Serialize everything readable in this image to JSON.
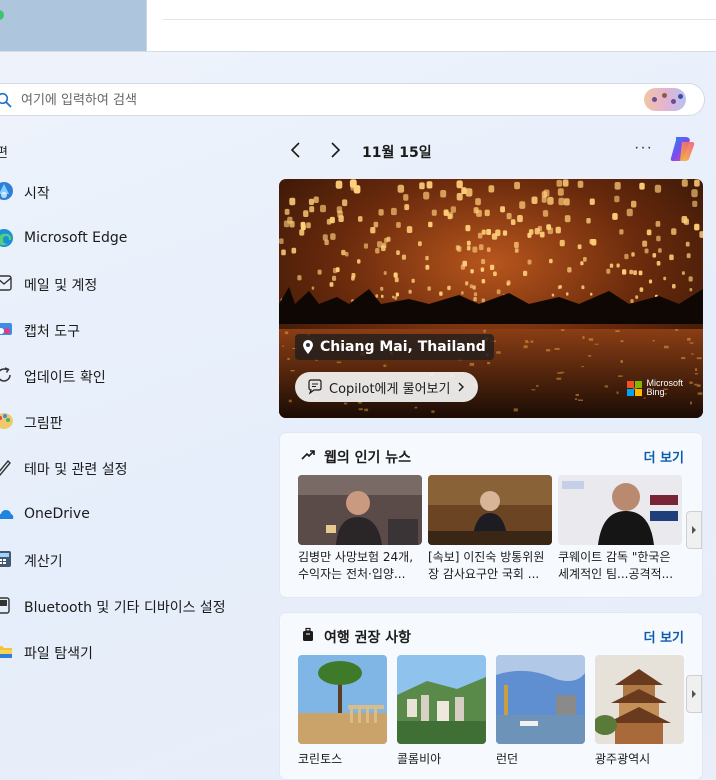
{
  "search": {
    "placeholder": "여기에 입력하여 검색"
  },
  "left": {
    "section_label": "편",
    "apps": [
      {
        "label": "시작",
        "icon": "tips-icon"
      },
      {
        "label": "Microsoft Edge",
        "icon": "edge-icon"
      },
      {
        "label": "메일 및 계정",
        "icon": "mail-icon"
      },
      {
        "label": "캡처 도구",
        "icon": "snipping-icon"
      },
      {
        "label": "업데이트 확인",
        "icon": "update-icon"
      },
      {
        "label": "그림판",
        "icon": "paint-icon"
      },
      {
        "label": "테마 및 관련 설정",
        "icon": "pen-icon"
      },
      {
        "label": "OneDrive",
        "icon": "onedrive-icon"
      },
      {
        "label": "계산기",
        "icon": "calculator-icon"
      },
      {
        "label": "Bluetooth 및 기타 디바이스 설정",
        "icon": "bluetooth-icon"
      },
      {
        "label": "파일 탐색기",
        "icon": "folder-icon"
      }
    ]
  },
  "nav": {
    "date": "11월 15일",
    "more": "···"
  },
  "hero": {
    "location": "Chiang Mai, Thailand",
    "ask_label": "Copilot에게 물어보기",
    "bing_text_1": "Microsoft",
    "bing_text_2": "Bing"
  },
  "news": {
    "title": "웹의 인기 뉴스",
    "more": "더 보기",
    "items": [
      {
        "text": "김병만 사망보험 24개, 수익자는 전처·입양..."
      },
      {
        "text": "[속보] 이진숙 방통위원장 감사요구안 국회 ..."
      },
      {
        "text": "쿠웨이트 감독 \"한국은 세계적인 팀...공격적..."
      }
    ]
  },
  "travel": {
    "title": "여행 권장 사항",
    "more": "더 보기",
    "items": [
      {
        "name": "코린토스"
      },
      {
        "name": "콜롬비아"
      },
      {
        "name": "런던"
      },
      {
        "name": "광주광역시"
      }
    ]
  },
  "colors": {
    "accent": "#0b5cad",
    "panel_bg": "#eaf0fa"
  }
}
